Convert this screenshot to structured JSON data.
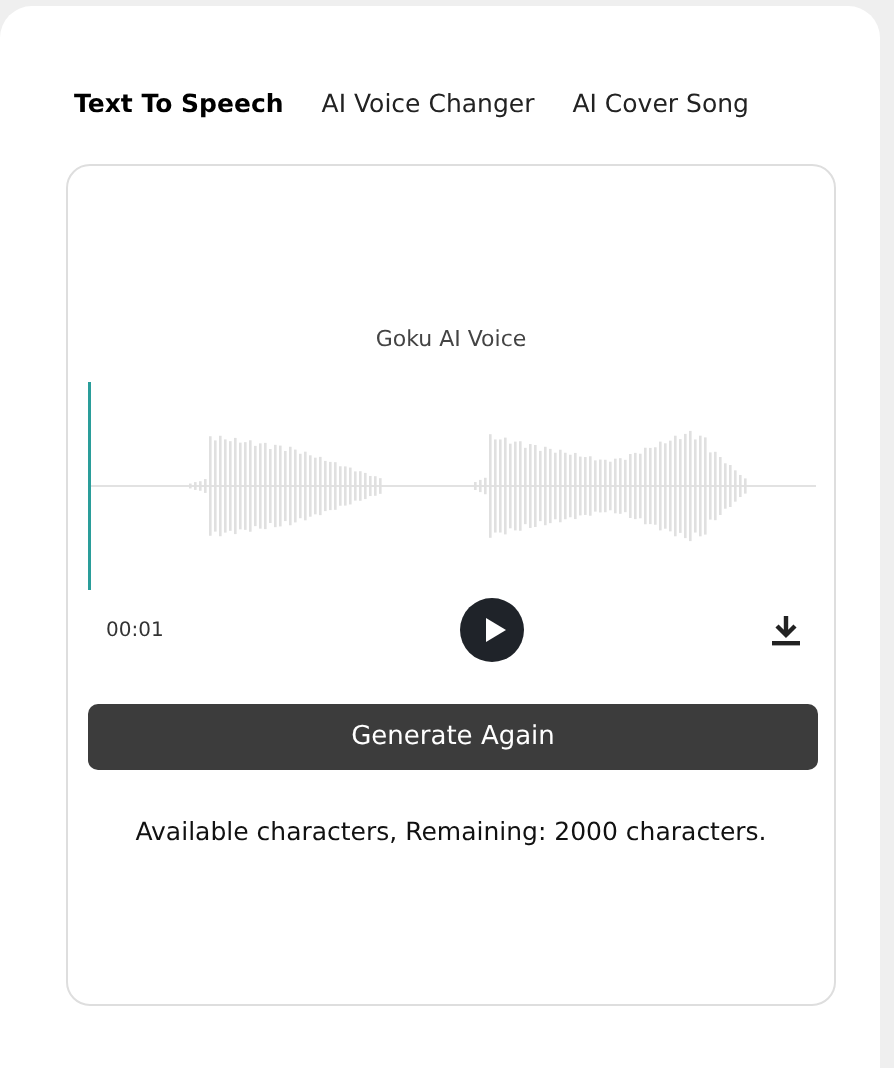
{
  "tabs": [
    {
      "label": "Text To Speech",
      "selected": true
    },
    {
      "label": "AI Voice Changer",
      "selected": false
    },
    {
      "label": "AI Cover Song",
      "selected": false
    }
  ],
  "player": {
    "title": "Goku AI Voice",
    "time": "00:01"
  },
  "generate_button": "Generate Again",
  "quota_text": "Available characters, Remaining: 2000 characters."
}
